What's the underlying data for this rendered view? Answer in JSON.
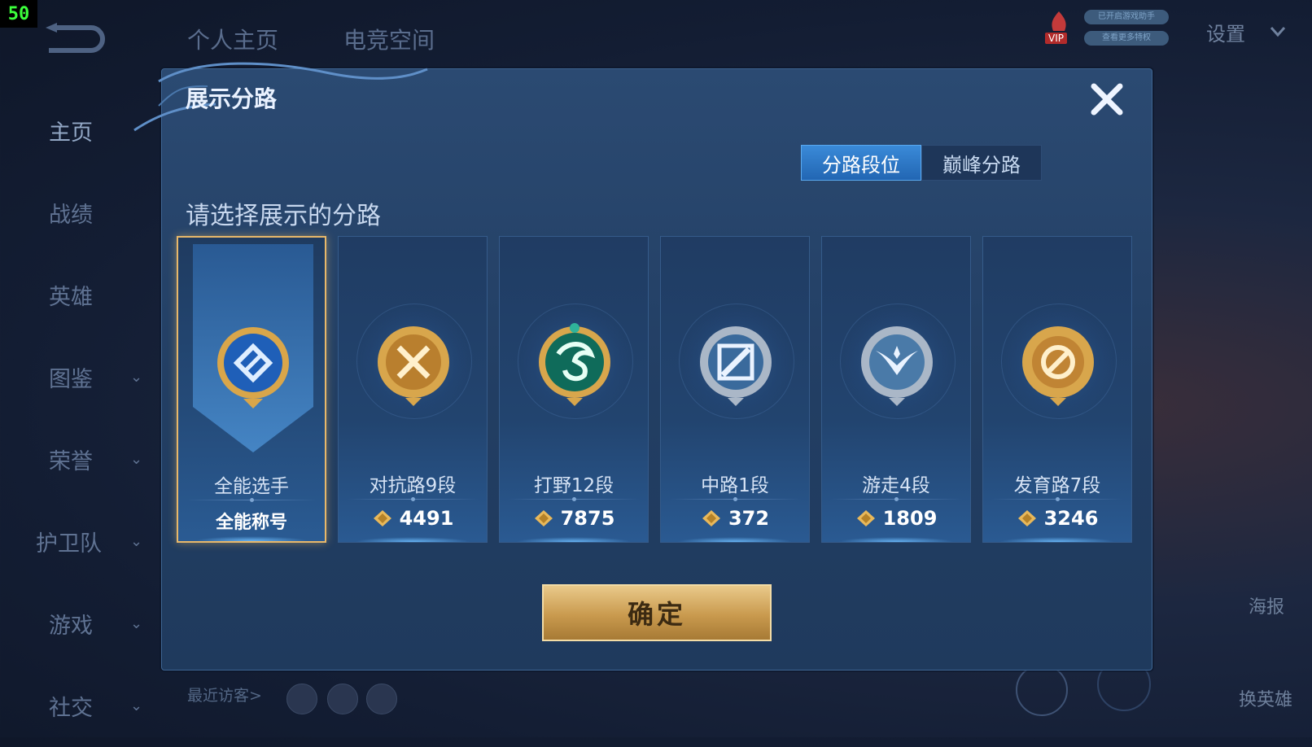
{
  "fps": "50",
  "top_nav": [
    "个人主页",
    "电竞空间"
  ],
  "vip_label": "VIP",
  "status_pills": [
    "已开启游戏助手",
    "查看更多特权"
  ],
  "settings_label": "设置",
  "sidebar": [
    {
      "label": "主页",
      "active": true,
      "chevron": false
    },
    {
      "label": "战绩",
      "active": false,
      "chevron": false
    },
    {
      "label": "英雄",
      "active": false,
      "chevron": false
    },
    {
      "label": "图鉴",
      "active": false,
      "chevron": true
    },
    {
      "label": "荣誉",
      "active": false,
      "chevron": true
    },
    {
      "label": "护卫队",
      "active": false,
      "chevron": true
    },
    {
      "label": "游戏",
      "active": false,
      "chevron": true
    },
    {
      "label": "社交",
      "active": false,
      "chevron": true
    }
  ],
  "recent_visitors_label": "最近访客>",
  "right_labels": {
    "poster": "海报",
    "change_hero": "换英雄"
  },
  "modal": {
    "title": "展示分路",
    "tabs": [
      {
        "label": "分路段位",
        "active": true
      },
      {
        "label": "巅峰分路",
        "active": false
      }
    ],
    "subtitle": "请选择展示的分路",
    "cards": [
      {
        "name": "全能选手",
        "bottom": "全能称号",
        "points": null,
        "selected": true,
        "badge": "all-round"
      },
      {
        "name": "对抗路9段",
        "bottom": null,
        "points": "4491",
        "selected": false,
        "badge": "clash-lane"
      },
      {
        "name": "打野12段",
        "bottom": null,
        "points": "7875",
        "selected": false,
        "badge": "jungle"
      },
      {
        "name": "中路1段",
        "bottom": null,
        "points": "372",
        "selected": false,
        "badge": "mid-lane"
      },
      {
        "name": "游走4段",
        "bottom": null,
        "points": "1809",
        "selected": false,
        "badge": "roam"
      },
      {
        "name": "发育路7段",
        "bottom": null,
        "points": "3246",
        "selected": false,
        "badge": "farm-lane"
      }
    ],
    "confirm_label": "确定"
  },
  "colors": {
    "accent_gold": "#e8b86a",
    "tab_active": "#2f7bcc",
    "panel": "#24436a"
  }
}
